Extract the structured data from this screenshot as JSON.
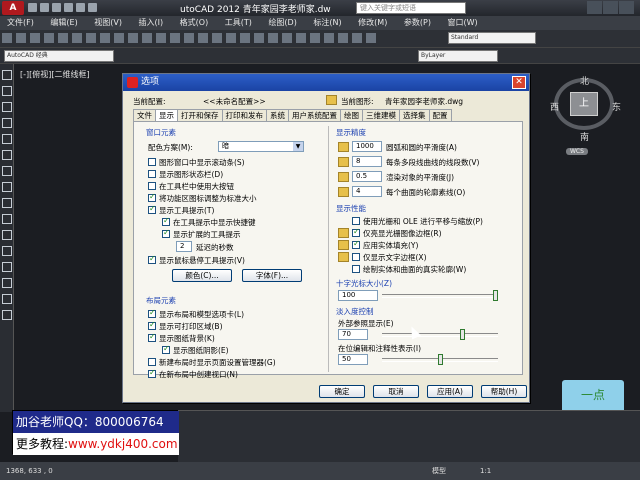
{
  "app": {
    "title": "utoCAD 2012    青年家园李老师家.dw",
    "search_placeholder": "键入关键字或短语",
    "icon_label": "A"
  },
  "menubar": [
    "文件(F)",
    "编辑(E)",
    "视图(V)",
    "插入(I)",
    "格式(O)",
    "工具(T)",
    "绘图(D)",
    "标注(N)",
    "修改(M)",
    "参数(P)",
    "窗口(W)"
  ],
  "toolbar": {
    "workspace": "AutoCAD 经典",
    "style": "Standard",
    "layer": "ByLayer"
  },
  "viewport": {
    "label": "[-][俯视][二维线框]"
  },
  "viewcube": {
    "north": "北",
    "south": "南",
    "west": "西",
    "east": "东",
    "top": "上",
    "wcs": "WCS"
  },
  "dialog": {
    "title": "选项",
    "current_config_label": "当前配置:",
    "current_config_value": "<<未命名配置>>",
    "current_drawing_label": "当前图形:",
    "current_drawing_value": "青年家园李老师家.dwg",
    "tabs": [
      "文件",
      "显示",
      "打开和保存",
      "打印和发布",
      "系统",
      "用户系统配置",
      "绘图",
      "三维建模",
      "选择集",
      "配置"
    ],
    "active_tab": "显示",
    "window_elements": {
      "title": "窗口元素",
      "color_scheme_label": "配色方案(M):",
      "color_scheme_value": "暗",
      "checkboxes": [
        {
          "label": "图形窗口中显示滚动条(S)",
          "checked": false
        },
        {
          "label": "显示图形状态栏(D)",
          "checked": false
        },
        {
          "label": "在工具栏中使用大按钮",
          "checked": false
        },
        {
          "label": "将功能区图标调整为标准大小",
          "checked": true
        },
        {
          "label": "显示工具提示(T)",
          "checked": true
        },
        {
          "label": "在工具提示中显示快捷键",
          "checked": true
        },
        {
          "label": "显示扩展的工具提示",
          "checked": true
        },
        {
          "label": "显示鼠标悬停工具提示(V)",
          "checked": true
        }
      ],
      "delay_value": "2",
      "delay_label": "延迟的秒数",
      "colors_button": "颜色(C)...",
      "fonts_button": "字体(F)..."
    },
    "layout_elements": {
      "title": "布局元素",
      "checkboxes": [
        {
          "label": "显示布局和模型选项卡(L)",
          "checked": true
        },
        {
          "label": "显示可打印区域(B)",
          "checked": true
        },
        {
          "label": "显示图纸背景(K)",
          "checked": true
        },
        {
          "label": "显示图纸阴影(E)",
          "checked": true
        },
        {
          "label": "新建布局时显示页面设置管理器(G)",
          "checked": false
        },
        {
          "label": "在新布局中创建视口(N)",
          "checked": true
        }
      ]
    },
    "display_resolution": {
      "title": "显示精度",
      "items": [
        {
          "value": "1000",
          "label": "圆弧和圆的平滑度(A)"
        },
        {
          "value": "8",
          "label": "每条多段线曲线的线段数(V)"
        },
        {
          "value": "0.5",
          "label": "渲染对象的平滑度(J)"
        },
        {
          "value": "4",
          "label": "每个曲面的轮廓素线(O)"
        }
      ]
    },
    "display_performance": {
      "title": "显示性能",
      "checkboxes": [
        {
          "label": "使用光栅和 OLE 进行平移与缩放(P)",
          "checked": false
        },
        {
          "label": "仅亮显光栅图像边框(R)",
          "checked": true
        },
        {
          "label": "应用实体填充(Y)",
          "checked": true
        },
        {
          "label": "仅显示文字边框(X)",
          "checked": false
        },
        {
          "label": "绘制实体和曲面的真实轮廓(W)",
          "checked": false
        }
      ]
    },
    "crosshair": {
      "title": "十字光标大小(Z)",
      "value": "100",
      "level": 1.0
    },
    "fade_control": {
      "title": "淡入度控制",
      "xref_label": "外部参照显示(E)",
      "xref_value": "70",
      "xref_level": 0.7,
      "inplace_label": "在位编辑和注释性表示(I)",
      "inplace_value": "50",
      "inplace_level": 0.5
    },
    "buttons": {
      "ok": "确定",
      "cancel": "取消",
      "apply": "应用(A)",
      "help": "帮助(H)"
    }
  },
  "ad": {
    "line1": "加谷老师QQ：800006764",
    "line2_prefix": "更多教程:",
    "line2_url": "www.ydkj400.com"
  },
  "status": {
    "coords": "1368,  633  ,  0",
    "model": "模型",
    "scale": "1:1"
  },
  "watermark": {
    "text": "一点"
  }
}
